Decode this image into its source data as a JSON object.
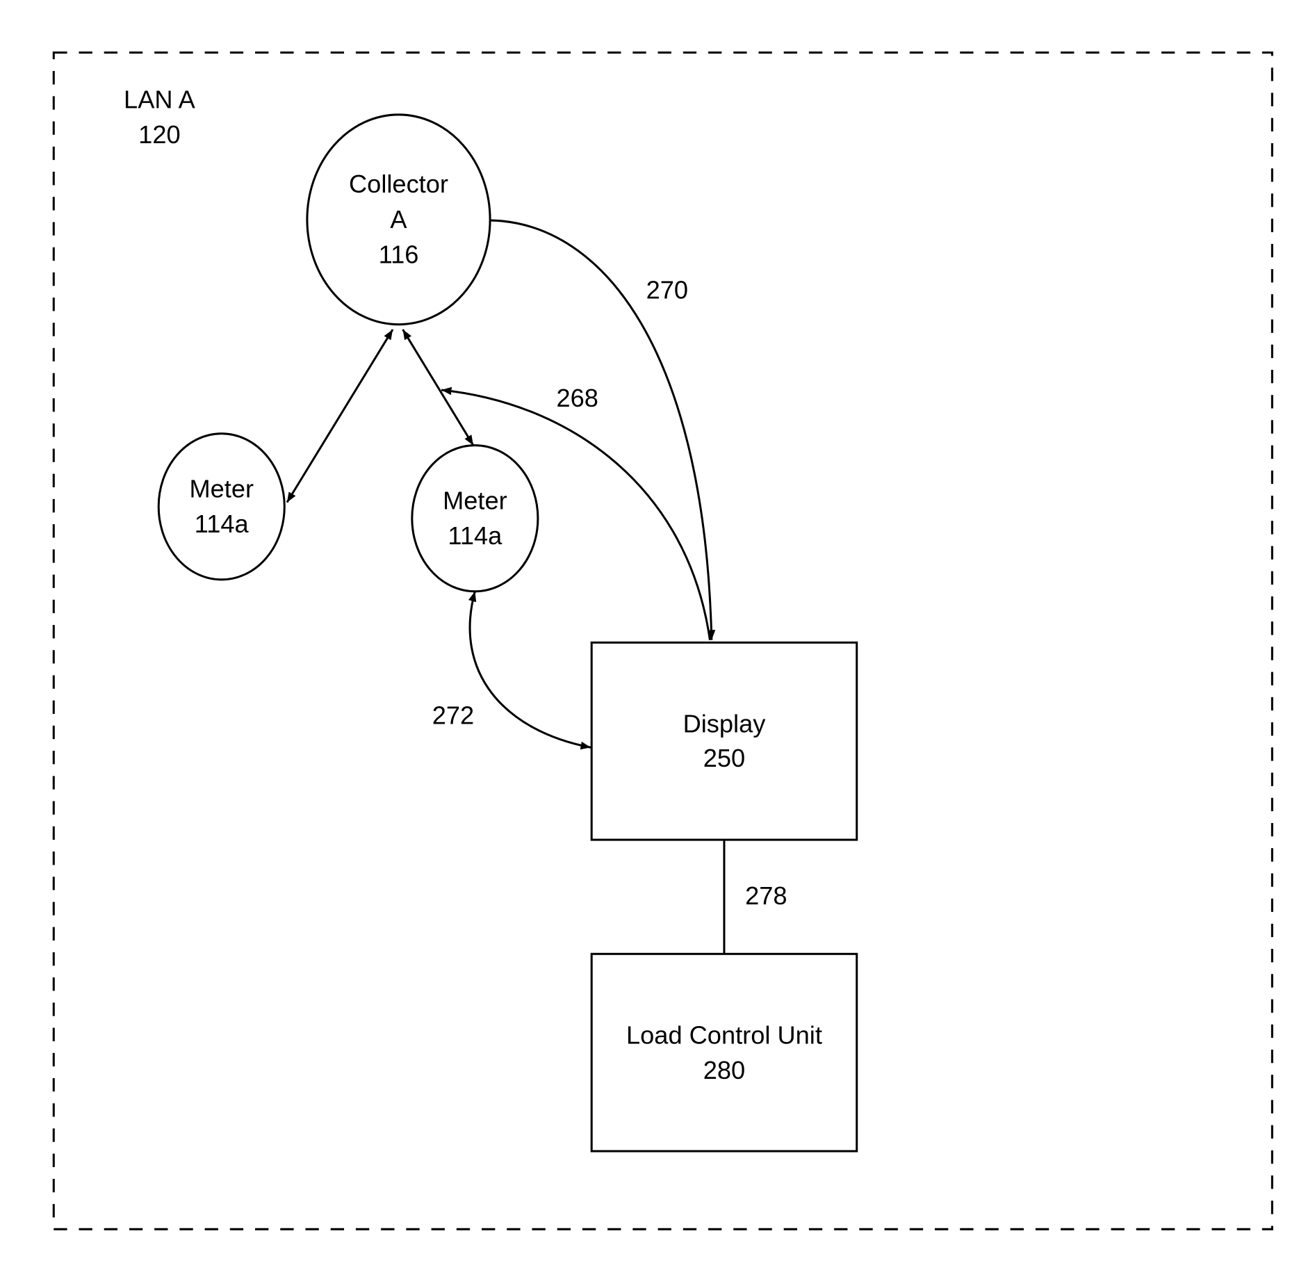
{
  "container": {
    "label": "LAN A",
    "ref": "120"
  },
  "nodes": {
    "collector": {
      "line1": "Collector",
      "line2": "A",
      "line3": "116"
    },
    "meter_left": {
      "line1": "Meter",
      "line2": "114a"
    },
    "meter_right": {
      "line1": "Meter",
      "line2": "114a"
    },
    "display": {
      "line1": "Display",
      "line2": "250"
    },
    "load_control": {
      "line1": "Load Control Unit",
      "line2": "280"
    }
  },
  "edges": {
    "e270": "270",
    "e268": "268",
    "e272": "272",
    "e278": "278"
  }
}
